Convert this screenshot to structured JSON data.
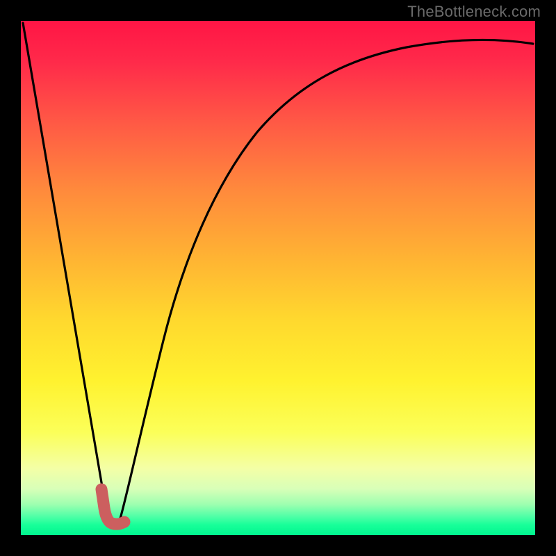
{
  "watermark": "TheBottleneck.com",
  "colors": {
    "frame": "#000000",
    "curve_stroke": "#000000",
    "marker_fill": "#cc5f5f",
    "marker_stroke": "#b84e4e",
    "gradient_top": "#ff1545",
    "gradient_bottom": "#00f58f"
  },
  "chart_data": {
    "type": "line",
    "title": "",
    "xlabel": "",
    "ylabel": "",
    "xlim": [
      0,
      100
    ],
    "ylim": [
      0,
      100
    ],
    "grid": false,
    "notes": "Axes are unlabeled; values are fractional positions (0–100) estimated from pixel geometry. Low y ≈ bottom (green / good), high y ≈ top (red / bad). Two strokes form a V with minimum near x≈16–19, y≈2.",
    "series": [
      {
        "name": "left-limb",
        "type": "line",
        "x": [
          0.4,
          4,
          8,
          12,
          15.4,
          16.6,
          17.6
        ],
        "y": [
          99.5,
          77,
          54,
          31,
          12,
          5.5,
          2.3
        ]
      },
      {
        "name": "right-limb",
        "type": "line",
        "x": [
          19.0,
          20.0,
          22.0,
          25.0,
          29.0,
          34.0,
          40.0,
          48.0,
          58.0,
          70.0,
          84.0,
          99.6
        ],
        "y": [
          2.3,
          6.0,
          17.0,
          33.0,
          50.0,
          63.0,
          73.5,
          81.5,
          87.5,
          91.5,
          94.0,
          95.5
        ]
      }
    ],
    "marker": {
      "name": "bottleneck-marker",
      "shape": "J-hook",
      "color": "#cc5f5f",
      "points_xy": [
        [
          15.7,
          8.9
        ],
        [
          16.2,
          5.2
        ],
        [
          16.9,
          3.1
        ],
        [
          18.0,
          2.4
        ],
        [
          19.2,
          2.2
        ],
        [
          20.1,
          2.5
        ]
      ]
    }
  }
}
